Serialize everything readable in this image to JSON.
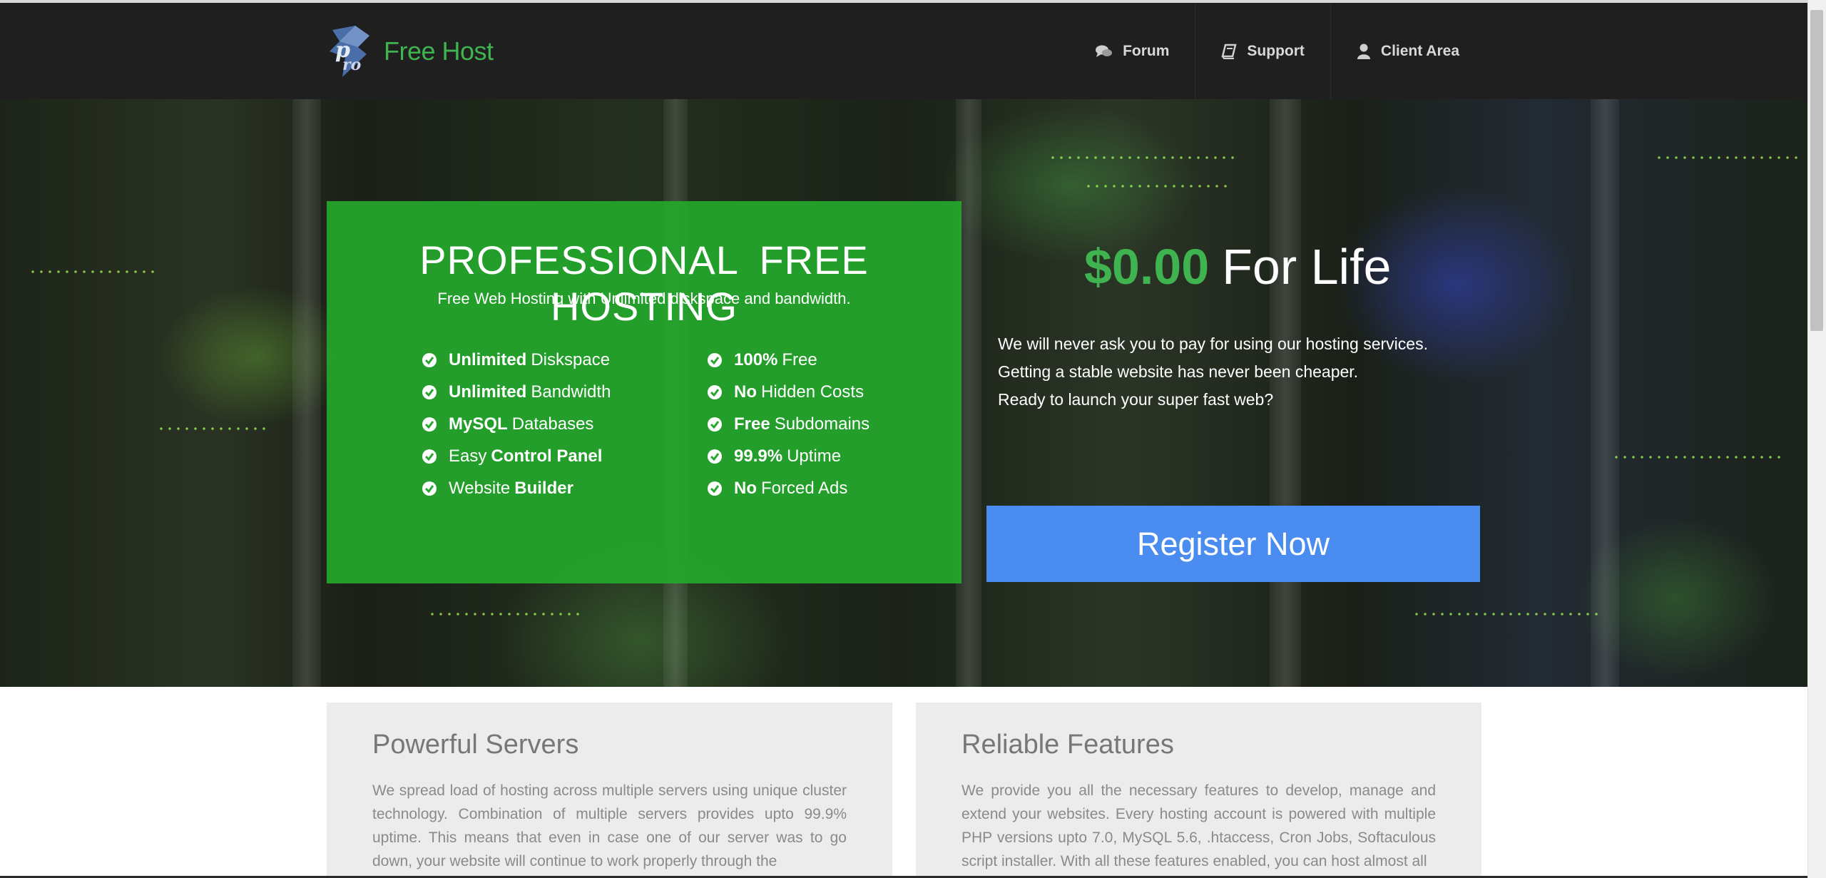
{
  "header": {
    "brand": "Free Host",
    "logo_icon": "pro-logo-icon",
    "nav": [
      {
        "label": "Forum",
        "icon": "comments-icon"
      },
      {
        "label": "Support",
        "icon": "book-icon"
      },
      {
        "label": "Client Area",
        "icon": "user-icon"
      }
    ]
  },
  "hero": {
    "title": "PROFESSIONAL FREE HOSTING",
    "subtitle": "Free Web Hosting with Unlimited diskspace and bandwidth.",
    "features_left": [
      {
        "bold": "Unlimited",
        "rest": "Diskspace",
        "bold_last": false
      },
      {
        "bold": "Unlimited",
        "rest": "Bandwidth",
        "bold_last": false
      },
      {
        "bold": "MySQL",
        "rest": "Databases",
        "bold_last": false
      },
      {
        "bold": "Control Panel",
        "rest": "Easy",
        "bold_last": true
      },
      {
        "bold": "Builder",
        "rest": "Website",
        "bold_last": true
      }
    ],
    "features_right": [
      {
        "bold": "100%",
        "rest": "Free"
      },
      {
        "bold": "No",
        "rest": "Hidden Costs"
      },
      {
        "bold": "Free",
        "rest": "Subdomains"
      },
      {
        "bold": "99.9%",
        "rest": "Uptime"
      },
      {
        "bold": "No",
        "rest": "Forced Ads"
      }
    ],
    "price_amount": "$0.00",
    "price_suffix": "For Life",
    "pitch_lines": [
      "We will never ask you to pay for using our hosting services.",
      "Getting a stable website has never been cheaper.",
      "Ready to launch your super fast web?"
    ],
    "register_label": "Register Now"
  },
  "cards": [
    {
      "title": "Powerful Servers",
      "text": "We spread load of hosting across multiple servers using unique cluster technology. Combination of multiple servers provides upto 99.9% uptime. This means that even in case one of our server was to go down, your website will continue to work properly through the"
    },
    {
      "title": "Reliable Features",
      "text": "We provide you all the necessary features to develop, manage and extend your websites. Every hosting account is powered with multiple PHP versions upto 7.0, MySQL 5.6, .htaccess, Cron Jobs, Softaculous script installer. With all these features enabled, you can host almost all"
    }
  ],
  "colors": {
    "brand_green": "#3fb34f",
    "promo_green": "#25a82d",
    "register_blue": "#4a8cf0",
    "header_bg": "#1f1f1f"
  }
}
